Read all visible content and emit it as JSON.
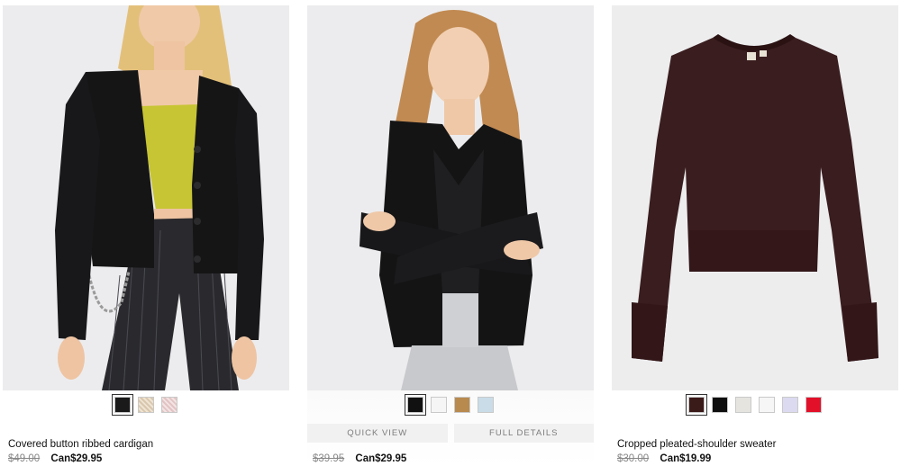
{
  "products": [
    {
      "title": "Covered button ribbed cardigan",
      "price_old": "$49.00",
      "price_new": "Can$29.95",
      "swatches": [
        "#1a1a1a",
        "#d8c7ad",
        "#e2c3c3"
      ],
      "selected_swatch": 0
    },
    {
      "title": "",
      "price_old": "$39.95",
      "price_new": "Can$29.95",
      "swatches": [
        "#111111",
        "#f5f5f5",
        "#b88a4e",
        "#c9dce8"
      ],
      "selected_swatch": 0,
      "quick_view_label": "QUICK VIEW",
      "full_details_label": "FULL DETAILS"
    },
    {
      "title": "Cropped pleated-shoulder sweater",
      "price_old": "$30.00",
      "price_new": "Can$19.99",
      "swatches": [
        "#3b1a1a",
        "#0f0f0f",
        "#e6e4df",
        "#f6f6f6",
        "#dcdaf0",
        "#e3102a"
      ],
      "selected_swatch": 0
    }
  ]
}
